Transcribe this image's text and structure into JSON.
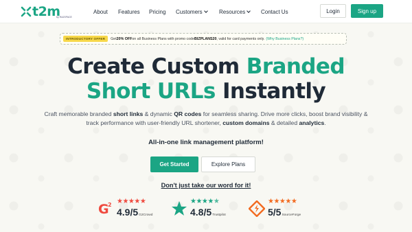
{
  "nav": {
    "logo_text": "t2m",
    "logo_sub": "by RAJSPACE",
    "links": [
      "About",
      "Features",
      "Pricing",
      "Customers",
      "Resources",
      "Contact Us"
    ],
    "login": "Login",
    "signup": "Sign up"
  },
  "promo": {
    "badge": "INTRODUCTORY OFFER",
    "text_before": "Get ",
    "discount": "20% OFF",
    "text_middle": " on all Business Plans with promo code ",
    "code": "BIZPLANS20",
    "text_after": ", valid for card payments only.",
    "link": "(Why Business Plans?)"
  },
  "hero": {
    "line1_dark": "Create Custom",
    "line1_green": "Branded",
    "line2_green": "Short URLs",
    "line2_dark": "Instantly",
    "sub_p1": "Craft memorable branded ",
    "sub_b1": "short links",
    "sub_p2": " & dynamic ",
    "sub_b2": "QR codes",
    "sub_p3": " for seamless sharing. Drive more clicks, boost brand visibility & track performance with user-friendly URL shortener, ",
    "sub_b3": "custom domains",
    "sub_p4": " & detailed ",
    "sub_b4": "analytics",
    "sub_p5": ".",
    "tagline": "All-in-one link management platform!",
    "cta_primary": "Get Started",
    "cta_secondary": "Explore Plans",
    "proof": "Don't just take our word for it!"
  },
  "ratings": [
    {
      "score": "4.9/5",
      "source": "G2Crowd",
      "icon": "g2-logo-icon",
      "stars": 5
    },
    {
      "score": "4.8/5",
      "source": "Trustpilot",
      "icon": "trustpilot-star-icon",
      "stars": 4.8
    },
    {
      "score": "5/5",
      "source": "SourceForge",
      "icon": "sourceforge-logo-icon",
      "stars": 5
    }
  ],
  "colors": {
    "brand": "#1ba584",
    "text": "#1f2a37",
    "star_red": "#ef4a3f",
    "star_green": "#1ba584",
    "star_orange": "#f26b21"
  }
}
